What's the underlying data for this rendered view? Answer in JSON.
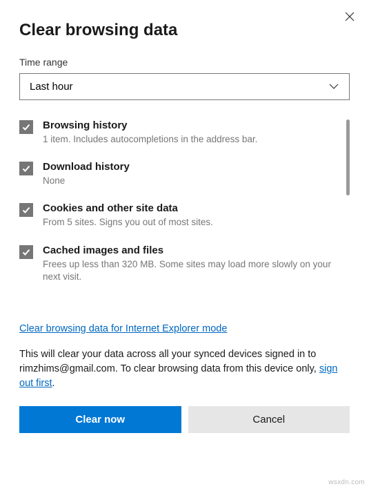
{
  "title": "Clear browsing data",
  "time_range_label": "Time range",
  "time_range_value": "Last hour",
  "options": [
    {
      "title": "Browsing history",
      "desc": "1 item. Includes autocompletions in the address bar.",
      "checked": true
    },
    {
      "title": "Download history",
      "desc": "None",
      "checked": true
    },
    {
      "title": "Cookies and other site data",
      "desc": "From 5 sites. Signs you out of most sites.",
      "checked": true
    },
    {
      "title": "Cached images and files",
      "desc": "Frees up less than 320 MB. Some sites may load more slowly on your next visit.",
      "checked": true
    }
  ],
  "ie_link": "Clear browsing data for Internet Explorer mode",
  "notice_pre": "This will clear your data across all your synced devices signed in to rimzhims@gmail.com. To clear browsing data from this device only, ",
  "notice_link": "sign out first",
  "notice_post": ".",
  "clear_btn": "Clear now",
  "cancel_btn": "Cancel",
  "watermark": "wsxdn.com"
}
